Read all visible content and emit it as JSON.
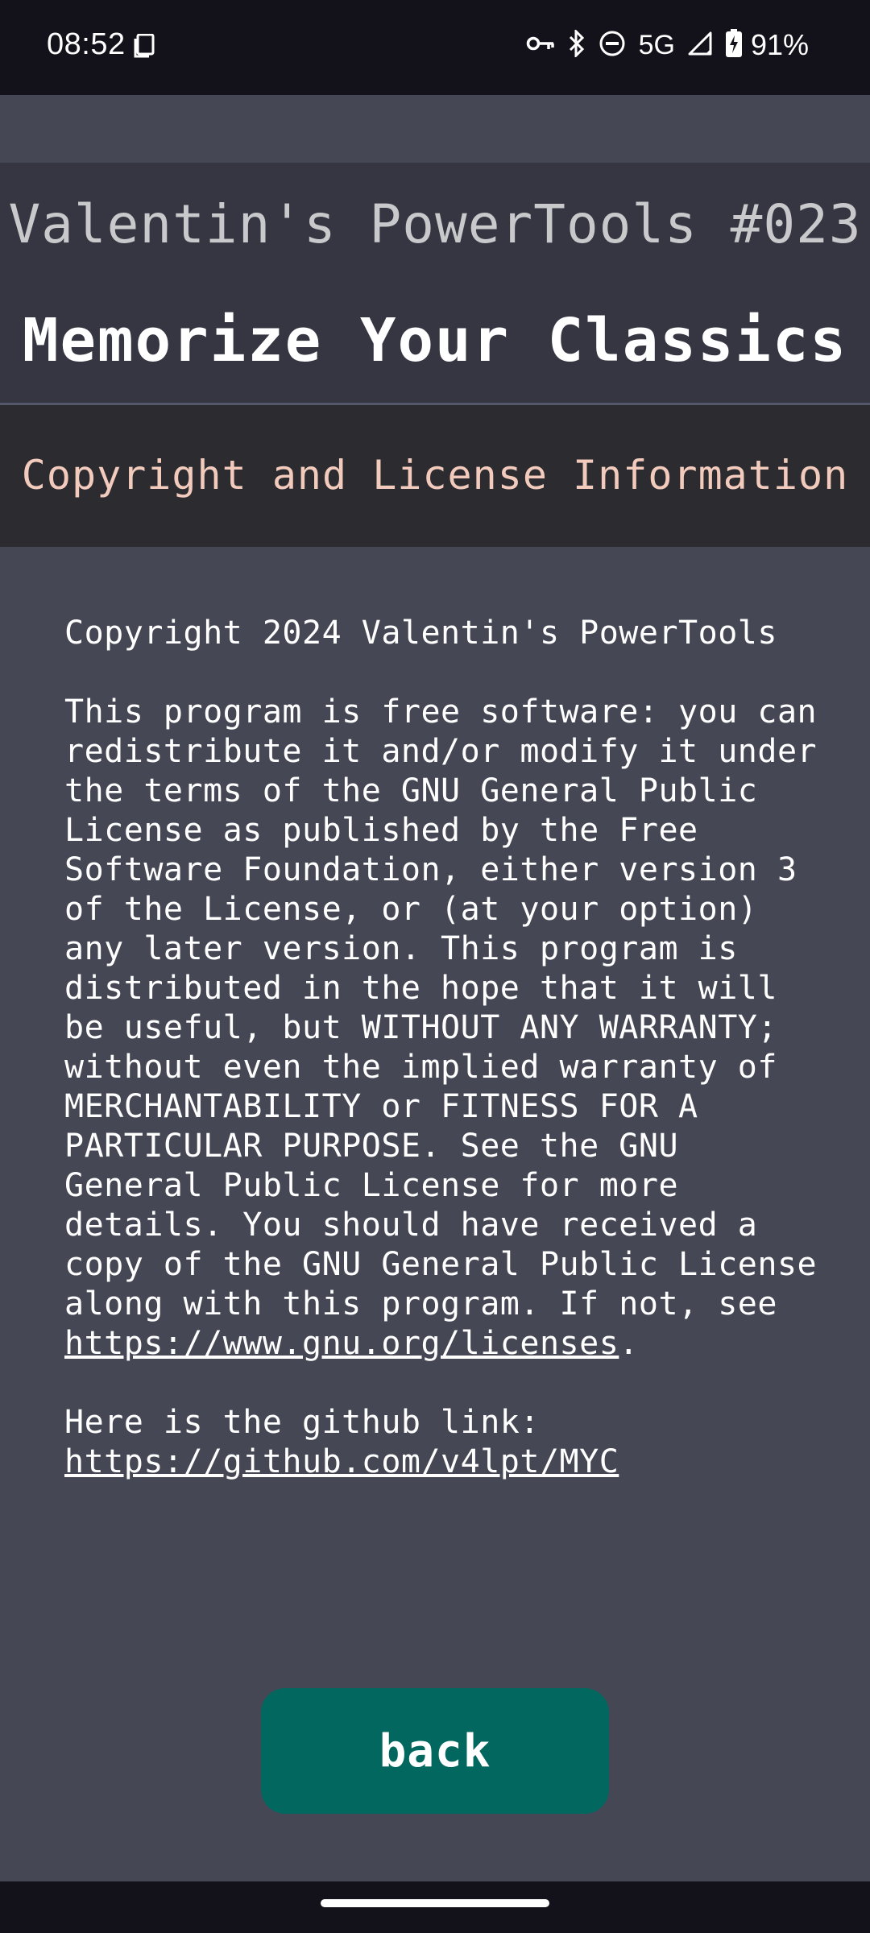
{
  "status_bar": {
    "time": "08:52",
    "network": "5G",
    "battery": "91%",
    "icons": [
      "screenshot-icon",
      "vpn-key-icon",
      "bluetooth-icon",
      "do-not-disturb-icon",
      "signal-icon",
      "battery-charging-icon"
    ]
  },
  "header": {
    "brand": "Valentin's PowerTools #023",
    "title": "Memorize Your Classics"
  },
  "section": {
    "title": "Copyright and License Information"
  },
  "license": {
    "copyright": "Copyright 2024 Valentin's PowerTools",
    "gpl_text": "This program is free software: you can redistribute it and/or modify it under the terms of the GNU General Public License as published by the Free Software Foundation, either version 3 of the License, or (at your option) any later version. This program is distributed in the hope that it will be useful, but WITHOUT ANY WARRANTY; without even the implied warranty of MERCHANTABILITY or FITNESS FOR A PARTICULAR PURPOSE. See the GNU General Public License for more details. You should have received a copy of the GNU General Public License along with this program. If not, see",
    "gpl_link": "https://www.gnu.org/licenses",
    "gpl_link_suffix": ".",
    "github_prefix": "Here is the github link:",
    "github_link": "https://github.com/v4lpt/MYC"
  },
  "actions": {
    "back_label": "back"
  },
  "colors": {
    "background": "#454754",
    "header": "#353642",
    "section_band": "#2b2b30",
    "section_title": "#f2cbbd",
    "button": "#02675f"
  }
}
